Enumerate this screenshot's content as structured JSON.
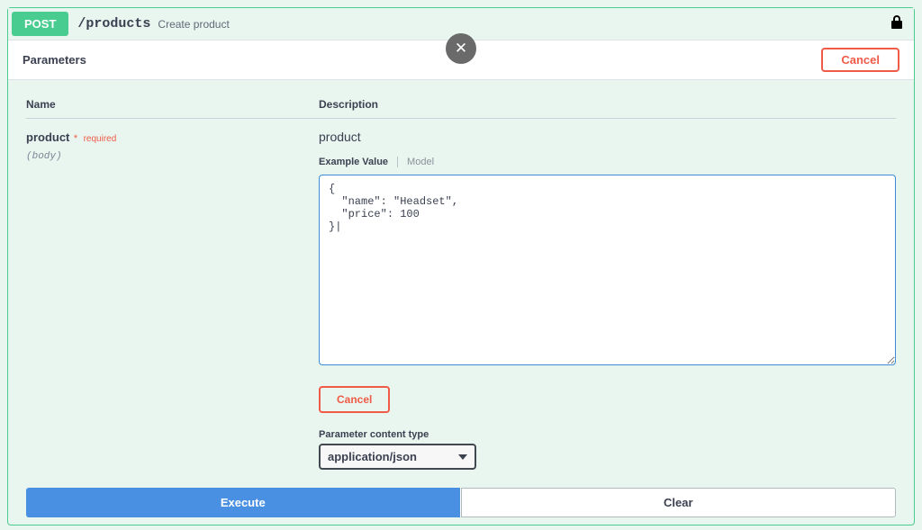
{
  "summary": {
    "method": "POST",
    "path": "/products",
    "description": "Create product"
  },
  "parametersBar": {
    "label": "Parameters",
    "cancel": "Cancel"
  },
  "table": {
    "nameHeader": "Name",
    "descHeader": "Description"
  },
  "param": {
    "name": "product",
    "requiredText": "required",
    "in": "(body)",
    "description": "product",
    "tabs": {
      "example": "Example Value",
      "model": "Model"
    },
    "bodyValue": "{\n  \"name\": \"Headset\",\n  \"price\": 100\n}|",
    "cancel": "Cancel",
    "contentTypeLabel": "Parameter content type",
    "contentTypeValue": "application/json"
  },
  "actions": {
    "execute": "Execute",
    "clear": "Clear"
  }
}
